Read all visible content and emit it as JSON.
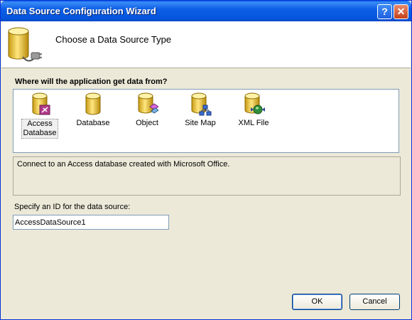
{
  "window": {
    "title": "Data Source Configuration Wizard",
    "help_label": "?",
    "close_label": "✕"
  },
  "header": {
    "title": "Choose a Data Source Type",
    "icon": "database-plug-icon"
  },
  "question": "Where will the application get data from?",
  "types": [
    {
      "label": "Access\nDatabase",
      "icon": "access-database-icon",
      "selected": true
    },
    {
      "label": "Database",
      "icon": "database-icon",
      "selected": false
    },
    {
      "label": "Object",
      "icon": "object-icon",
      "selected": false
    },
    {
      "label": "Site Map",
      "icon": "site-map-icon",
      "selected": false
    },
    {
      "label": "XML File",
      "icon": "xml-file-icon",
      "selected": false
    }
  ],
  "description": "Connect to an Access database created with Microsoft Office.",
  "id_field": {
    "label": "Specify an ID for the data source:",
    "value": "AccessDataSource1"
  },
  "buttons": {
    "ok": "OK",
    "cancel": "Cancel"
  }
}
